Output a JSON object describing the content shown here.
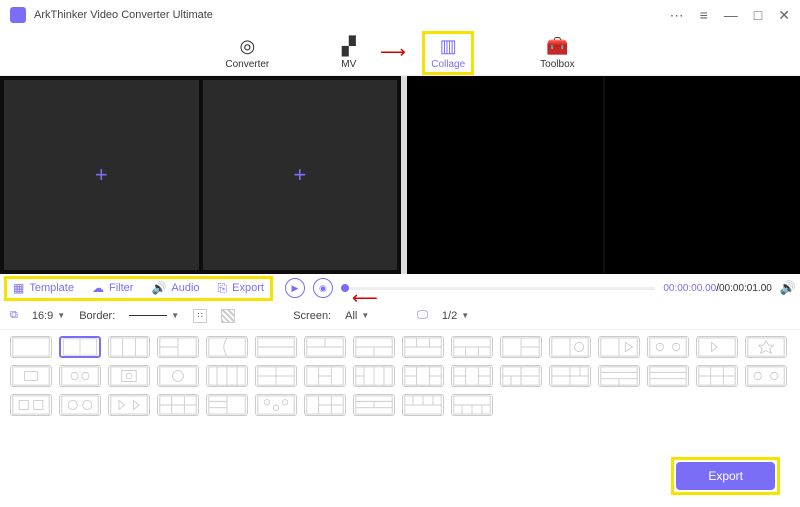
{
  "app": {
    "title": "ArkThinker Video Converter Ultimate"
  },
  "tabs": {
    "converter": "Converter",
    "mv": "MV",
    "collage": "Collage",
    "toolbox": "Toolbox"
  },
  "mid": {
    "template": "Template",
    "filter": "Filter",
    "audio": "Audio",
    "export": "Export"
  },
  "time": {
    "current": "00:00:00.00",
    "sep": "/",
    "duration": "00:00:01.00"
  },
  "toolbar": {
    "aspect": "16:9",
    "border_label": "Border:",
    "screen_label": "Screen:",
    "screen_value": "All",
    "page": "1/2"
  },
  "footer": {
    "export": "Export"
  },
  "colors": {
    "accent": "#7b6ef6",
    "highlight": "#f5e400"
  }
}
